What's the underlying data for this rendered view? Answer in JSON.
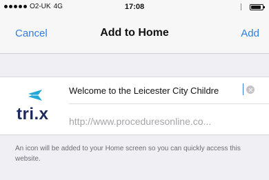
{
  "status_bar": {
    "carrier": "O2-UK",
    "network": "4G",
    "time": "17:08",
    "battery_level": 0.85
  },
  "nav": {
    "cancel_label": "Cancel",
    "title": "Add to Home",
    "add_label": "Add"
  },
  "shortcut": {
    "icon_text": "tri.x",
    "name_value": "Welcome to the Leicester City Childre",
    "url": "http://www.proceduresonline.co..."
  },
  "info_text": "An icon will be added to your Home screen so you can quickly access this website.",
  "colors": {
    "accent": "#2f7de1",
    "logo_dark": "#1d2a5c",
    "logo_plane": "#22a7d6",
    "background": "#efeff4"
  }
}
